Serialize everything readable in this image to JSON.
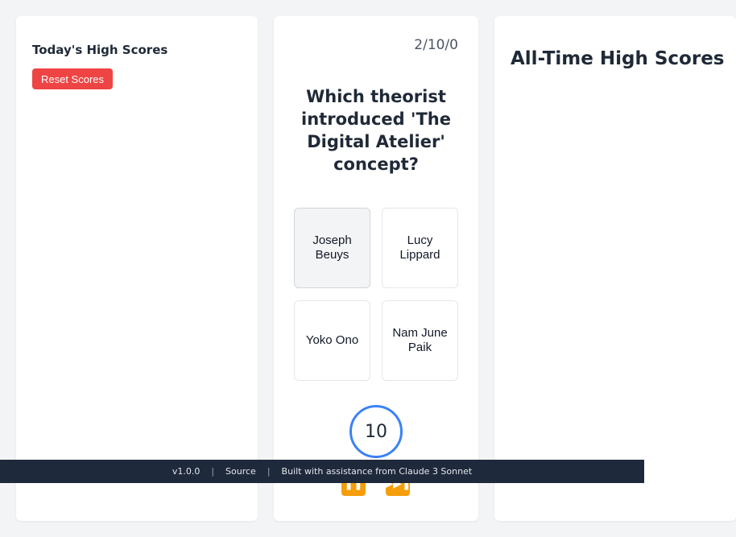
{
  "left_panel": {
    "title": "Today's High Scores",
    "reset_label": "Reset Scores"
  },
  "quiz": {
    "score_counter": "2/10/0",
    "question": "Which theorist introduced 'The Digital Atelier' concept?",
    "answers": [
      "Joseph Beuys",
      "Lucy Lippard",
      "Yoko Ono",
      "Nam June Paik"
    ],
    "timer": "10",
    "pause_icon": "pause-icon",
    "skip_icon": "skip-forward-icon"
  },
  "right_panel": {
    "title": "All-Time High Scores"
  },
  "footer": {
    "version": "v1.0.0",
    "separator": "|",
    "source_label": "Source",
    "credit": "Built with assistance from Claude 3 Sonnet"
  },
  "colors": {
    "reset_button": "#ef4444",
    "timer_ring": "#3b82f6",
    "control_button": "#f59e0b",
    "footer_bg": "#1e293b"
  }
}
